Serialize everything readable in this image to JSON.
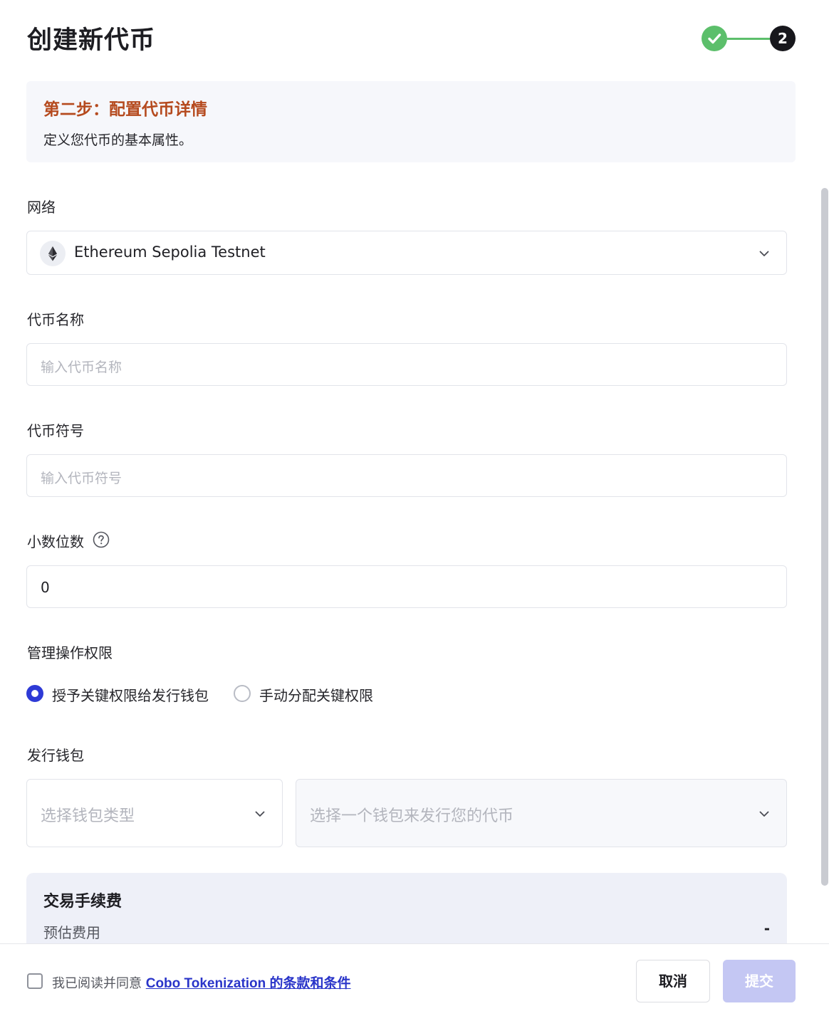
{
  "header": {
    "title": "创建新代币",
    "stepper": {
      "completed_step": 1,
      "current_step": "2"
    }
  },
  "info": {
    "title": "第二步：配置代币详情",
    "description": "定义您代币的基本属性。"
  },
  "network": {
    "label": "网络",
    "value": "Ethereum Sepolia Testnet",
    "icon": "ethereum-icon"
  },
  "token_name": {
    "label": "代币名称",
    "placeholder": "输入代币名称",
    "value": ""
  },
  "token_symbol": {
    "label": "代币符号",
    "placeholder": "输入代币符号",
    "value": ""
  },
  "decimals": {
    "label": "小数位数",
    "value": "0",
    "help_icon": "question-circle-icon"
  },
  "permissions": {
    "label": "管理操作权限",
    "options": [
      {
        "label": "授予关键权限给发行钱包",
        "selected": true
      },
      {
        "label": "手动分配关键权限",
        "selected": false
      }
    ]
  },
  "issuing_wallet": {
    "label": "发行钱包",
    "type_placeholder": "选择钱包类型",
    "wallet_placeholder": "选择一个钱包来发行您的代币"
  },
  "fee": {
    "title": "交易手续费",
    "estimate_label": "预估费用",
    "estimate_value": "-"
  },
  "footer": {
    "agree_prefix": "我已阅读并同意 ",
    "agree_link": "Cobo Tokenization 的条款和条件",
    "cancel_label": "取消",
    "submit_label": "提交"
  },
  "colors": {
    "accent": "#2e3ad6",
    "success": "#5cbf6b",
    "step_title": "#b54a1e",
    "submit_disabled": "#c4c7f3"
  }
}
